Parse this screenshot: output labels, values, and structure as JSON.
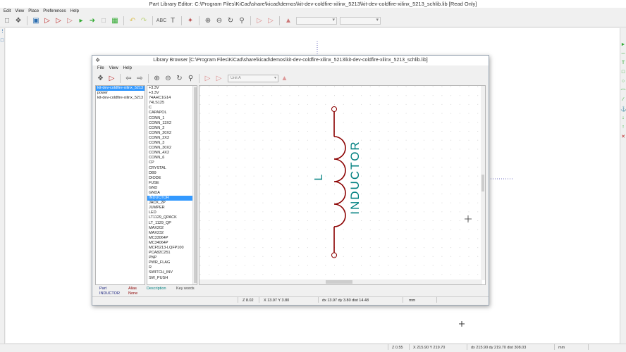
{
  "window": {
    "title": "Part Library Editor: C:\\Program Files\\KiCad\\share\\kicad\\demos\\kit-dev-coldfire-xilinx_5213\\kit-dev-coldfire-xilinx_5213_schlib.lib [Read Only]"
  },
  "menubar": {
    "items": [
      "Edit",
      "View",
      "Place",
      "Preferences",
      "Help"
    ]
  },
  "status": {
    "zoom": "Z 0.55",
    "xy": "X 215.90  Y 219.70",
    "delta": "dx 215.90  dy 219.70  dist 308.03",
    "units": "mm"
  },
  "browser": {
    "title": "Library Browser [C:\\Program Files\\KiCad\\share\\kicad\\demos\\kit-dev-coldfire-xilinx_5213\\kit-dev-coldfire-xilinx_5213_schlib.lib]",
    "menu": [
      "File",
      "View",
      "Help"
    ],
    "unit_select": "Unit A",
    "libraries": [
      "kit-dev-coldfire-xilinx_5213",
      "power",
      "kit-dev-coldfire-xilinx_5213"
    ],
    "selected_library": 0,
    "components": [
      "+3.3V",
      "+3.3V",
      "74AHC1G14",
      "74LS125",
      "C",
      "CAPAPOL",
      "CONN_1",
      "CONN_13X2",
      "CONN_2",
      "CONN_20X2",
      "CONN_2X2",
      "CONN_3",
      "CONN_30X2",
      "CONN_4X2",
      "CONN_6",
      "CP",
      "CRYSTAL",
      "DB9",
      "DIODE",
      "FUSE",
      "GND",
      "GNDA",
      "INDUCTOR",
      "JACK_2P",
      "JUMPER",
      "LED",
      "LT1129_QPACK",
      "LT_1129_QP",
      "MAX202",
      "MAX232",
      "MC33064P",
      "MC34064P",
      "MCF5213-LQFP100",
      "PCA82C251",
      "PNP",
      "PWR_FLAG",
      "R",
      "SWITCH_INV",
      "SW_PUSH"
    ],
    "selected_component": 22,
    "symbol": {
      "reference": "L",
      "value": "INDUCTOR"
    },
    "info": {
      "headers": {
        "part": "Part",
        "alias": "Alias",
        "description": "Description",
        "keywords": "Key words"
      },
      "part": "INDUCTOR",
      "alias": "None"
    },
    "status": {
      "zoom": "Z 8.02",
      "xy": "X 13.97  Y 3.80",
      "delta": "dx 13.97  dy 3.80  dist 14.48",
      "units": "mm"
    }
  },
  "colors": {
    "symbol_body": "#8b0000",
    "symbol_text": "#008080",
    "selection": "#3399ff",
    "sheet_border": "#7070c0"
  }
}
